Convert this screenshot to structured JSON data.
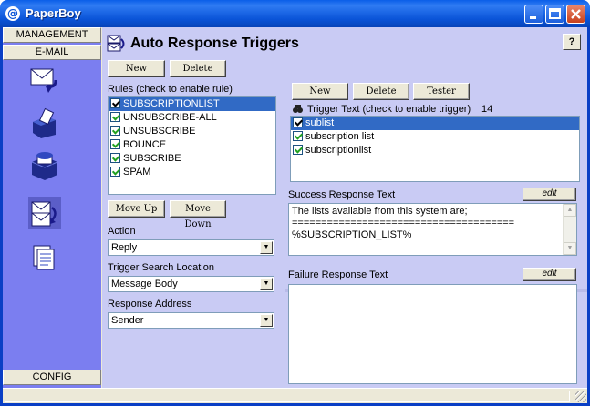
{
  "window": {
    "title": "PaperBoy",
    "controls": [
      "minimize",
      "maximize",
      "close"
    ]
  },
  "nav": {
    "management_label": "MANAGEMENT",
    "email_label": "E-MAIL",
    "config_label": "CONFIG",
    "icons": [
      "mail-forward-icon",
      "mailbox-send-icon",
      "mailbox-open-icon",
      "auto-response-icon",
      "documents-icon"
    ],
    "selected_icon": "auto-response-icon"
  },
  "header": {
    "title": "Auto Response Triggers",
    "help_label": "?"
  },
  "rules": {
    "new_label": "New",
    "delete_label": "Delete",
    "list_label": "Rules (check to enable rule)",
    "items": [
      {
        "label": "SUBSCRIPTIONLIST",
        "checked": true,
        "selected": true
      },
      {
        "label": "UNSUBSCRIBE-ALL",
        "checked": true,
        "selected": false
      },
      {
        "label": "UNSUBSCRIBE",
        "checked": true,
        "selected": false
      },
      {
        "label": "BOUNCE",
        "checked": true,
        "selected": false
      },
      {
        "label": "SUBSCRIBE",
        "checked": true,
        "selected": false
      },
      {
        "label": "SPAM",
        "checked": true,
        "selected": false
      }
    ],
    "move_up_label": "Move Up",
    "move_down_label": "Move Down"
  },
  "action": {
    "label": "Action",
    "value": "Reply"
  },
  "trigger_search": {
    "label": "Trigger Search Location",
    "value": "Message Body"
  },
  "response_address": {
    "label": "Response Address",
    "value": "Sender"
  },
  "triggers": {
    "new_label": "New",
    "delete_label": "Delete",
    "tester_label": "Tester",
    "list_label": "Trigger Text (check to enable trigger)",
    "count": "14",
    "items": [
      {
        "label": "sublist",
        "checked": true,
        "selected": true
      },
      {
        "label": "subscription list",
        "checked": true,
        "selected": false
      },
      {
        "label": "subscriptionlist",
        "checked": true,
        "selected": false
      }
    ]
  },
  "success": {
    "label": "Success Response Text",
    "edit_label": "edit",
    "text": "The lists available from this system are;\n======================================\n%SUBSCRIPTION_LIST%"
  },
  "failure": {
    "label": "Failure Response Text",
    "edit_label": "edit",
    "text": ""
  },
  "colors": {
    "titlebar": "#0a54d8",
    "nav_background": "#7b7ef0",
    "content_background": "#c9cbf4",
    "selection": "#316ac5"
  }
}
